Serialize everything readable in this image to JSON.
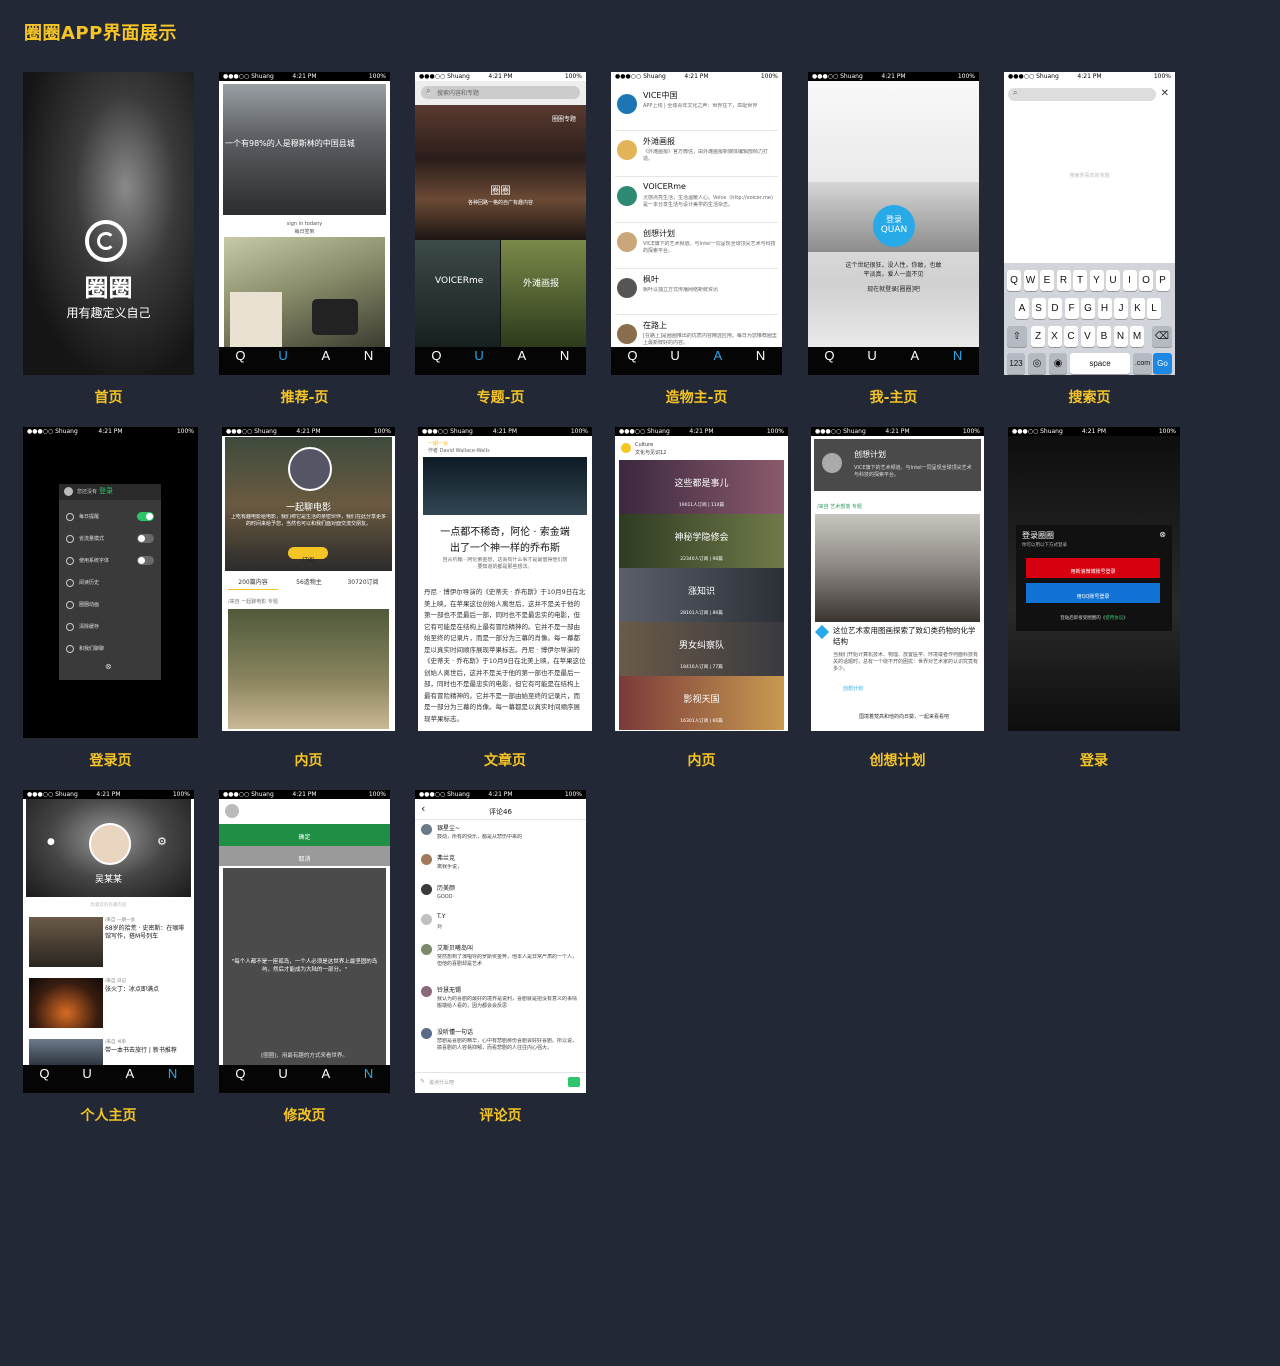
{
  "page_title": "圈圈APP界面展示",
  "captions": {
    "s1": "首页",
    "s2": "推荐-页",
    "s3": "专题-页",
    "s4": "造物主-页",
    "s5": "我-主页",
    "s6": "搜索页",
    "s7": "登录页",
    "s8": "内页",
    "s9": "文章页",
    "s10": "内页",
    "s11": "创想计划",
    "s12": "登录",
    "s13": "个人主页",
    "s14": "修改页",
    "s15": "评论页"
  },
  "status": {
    "carrier": "●●●○○ Shuang",
    "time": "4:21 PM",
    "battery": "100%"
  },
  "tabs": [
    {
      "letter": "Q"
    },
    {
      "letter": "U"
    },
    {
      "letter": "A"
    },
    {
      "letter": "N"
    }
  ],
  "colors": {
    "background": "#232836",
    "accent": "#f5c526",
    "blue": "#28a9e8",
    "green": "#1e8f45"
  },
  "splash": {
    "brand": "圈圈",
    "slogan": "用有趣定义自己"
  },
  "recommend": {
    "headline": "一个有98%的人是穆斯林的中国县城",
    "sign_in": "sign in todany",
    "sign_sub": "每日签到"
  },
  "topics": {
    "search_placeholder": "搜索内容和专题",
    "badge": "圈圈专题",
    "hero_title": "圈圈",
    "hero_sub": "各种回路一格的自广有趣内容",
    "tile1": "VOICERme",
    "tile2": "外滩画报"
  },
  "creators": [
    {
      "name": "VICE中国",
      "desc": "APP上线 | 全球青年文化之声：世界在下，匹配世界"
    },
    {
      "name": "外滩画报",
      "desc": "《外滩画报》官方微信，由外滩画报新媒体编辑部倾力打造。"
    },
    {
      "name": "VOICERme",
      "desc": "灵感点亮生活，生活温暖人心。Voice（http://voicer.me)是一本分享生活与设计美学的生活杂志。"
    },
    {
      "name": "创想计划",
      "desc": "VICE旗下的艺术频道。与Intel一同呈现全球顶尖艺术与科技的探索平台。"
    },
    {
      "name": "枫叶",
      "desc": "枫叶以独立方式传播网络新鲜资讯"
    },
    {
      "name": "在路上",
      "desc": "[在路上]是圈圈推出的优质内容精选应用。每日为您推荐圈里上最新鲜好的内容。"
    }
  ],
  "me": {
    "login_top": "登录",
    "login_bottom": "QUAN",
    "text1": "这个世纪很狂，没人性，你敢，也敢",
    "text2": "平淡真，爱人一直不见",
    "link": "现在就登录[圈圈]吧"
  },
  "search": {
    "hint": "搜索你喜欢的专题",
    "rows": [
      [
        "Q",
        "W",
        "E",
        "R",
        "T",
        "Y",
        "U",
        "I",
        "O",
        "P"
      ],
      [
        "A",
        "S",
        "D",
        "F",
        "G",
        "H",
        "J",
        "K",
        "L"
      ],
      [
        "Z",
        "X",
        "C",
        "V",
        "B",
        "N",
        "M"
      ]
    ],
    "k123": "123",
    "space": "space",
    "com": ".com",
    "go": "Go"
  },
  "menu": {
    "prompt": "您还没有",
    "login": "登录",
    "items": [
      "每日提醒",
      "省流量模式",
      "使用系统字体",
      "阅读历史",
      "圈圈动画",
      "清除缓存",
      "和我们聊聊"
    ]
  },
  "inner1": {
    "title": "一起聊电影",
    "desc": "上吃有趣电影给电影，我们称它是生活的亲密伙伴，我们在此分享更多的时间来给予您，当然也可以和我们面对面交流交朋友。",
    "subscribe": "订阅",
    "stats": [
      "200篇内容",
      "56造物主",
      "30720订阅"
    ],
    "source": "/来自 一起聊电影 专题"
  },
  "article": {
    "column": "一期一会",
    "author": "作者 David Wallace-Wells",
    "title1": "一点都不稀奇，阿伦 · 索金端",
    "title2": "出了一个神一样的乔布斯",
    "summary": "自从约翰 · 阿伦索金想，这会有什么事才是最值得他们想要知道的都是那些想法。",
    "body": "丹尼 · 博伊尔导演的《史蒂夫 · 乔布斯》于10月9日在北美上映，在苹果这位创始人离世后，这并不是关于他的第一部也不是最后一部，同时也不是最忠实的电影，但它有可能是在结构上最有冒险精神的。它并不是一部由始至终的记录片，而是一部分为三幕的肖像。每一幕都是以真实时间顺序展现苹果标志。丹尼 · 博伊尔导演的《史蒂夫 · 乔布斯》于10月9日在北美上映，在苹果这位创始人离世后，这并不是关于他的第一部也不是最后一部，同时也不是最忠实的电影，但它有可能是在结构上最有冒险精神的。它并不是一部由始至终的记录片，而是一部分为三幕的肖像。每一幕都是以真实时间顺序展现苹果标志。"
  },
  "inner2": {
    "column": "Culture",
    "sub": "文化与见识12",
    "items": [
      {
        "title": "这些都是事儿",
        "meta": "19011人订阅 | 114篇"
      },
      {
        "title": "神秘学隐修会",
        "meta": "22340人订阅 | 98篇"
      },
      {
        "title": "涨知识",
        "meta": "28101人订阅 | 86篇"
      },
      {
        "title": "男女纠察队",
        "meta": "18410人订阅 | 77篇"
      },
      {
        "title": "影视天国",
        "meta": "16301人订阅 | 66篇"
      }
    ]
  },
  "idea": {
    "title": "创想计划",
    "desc": "VICE旗下的艺术频道。与Intel一同呈现全球顶尖艺术与科技的探索平台。",
    "tag": "/来自 艺术部落 专题",
    "headline": "这位艺术家用图画探索了致幻类药物的化学结构",
    "body": "当我们开始计算机技术、物理、放置医学、环境或者作何面科技有关的话题时，总有一个绕不开的困扰：世界对艺术家的认识究竟有多少。",
    "source": "创想计划",
    "next": "国境着梵高和他的向日葵，一起来看看吧"
  },
  "login2": {
    "title": "登录圈圈",
    "sub": "你可以用以下方式登录",
    "weibo": "用新浪微博账号登录",
    "qq": "用QQ账号登录",
    "agree_pre": "登陆后即接受圈圈的《",
    "agree_link": "使用协议",
    "agree_post": "》"
  },
  "profile": {
    "name": "吴某某",
    "hint": "你喜欢的有趣内容",
    "posts": [
      {
        "tag": "/来自 一期一会",
        "title": "68岁的拾荒 · 史密斯：在咖啡馆写作，搭M号列车"
      },
      {
        "tag": "/来自 日记",
        "title": "张火丁：冰点即满点"
      },
      {
        "tag": "/来自 书单",
        "title": "带一本书去旅行 | 新书推荐"
      }
    ]
  },
  "edit": {
    "confirm": "确定",
    "cancel": "取消",
    "quote": "\"每个人都不是一座孤岛，一个人必须是这世界上最坚固的岛屿，然后才能成为大陆的一部分。\"",
    "footer": "[圈圈]，用最有趣的方式来看世界。"
  },
  "comments": {
    "title": "评论46",
    "input_placeholder": "说点什么吧",
    "items": [
      {
        "name": "银星尘~",
        "text": "鼓动，所有的快乐，都是从悲伤中来的"
      },
      {
        "name": "弗兰克",
        "text": "离我手说，"
      },
      {
        "name": "历美颜",
        "text": "GOOD"
      },
      {
        "name": "T.Y",
        "text": "对"
      },
      {
        "name": "艾斯贝曦岛叫",
        "text": "突然想到了演唱导的罗斯奖金奔，他本人是非常严肃的一个人，但他的喜剧却是艺术"
      },
      {
        "name": "铃慧无锡",
        "text": "我认为的喜剧的最好的境界是说利，喜剧就是把没有意义的事情搬端给人看的，因为都会会反思"
      },
      {
        "name": "没听懂一句话",
        "text": "悲剧是喜剧的精华，心中有悲剧那份喜剧会好好喜剧。所以说，搞喜剧的人容易抑郁，而看悲剧的人往往内心强大。"
      }
    ]
  }
}
